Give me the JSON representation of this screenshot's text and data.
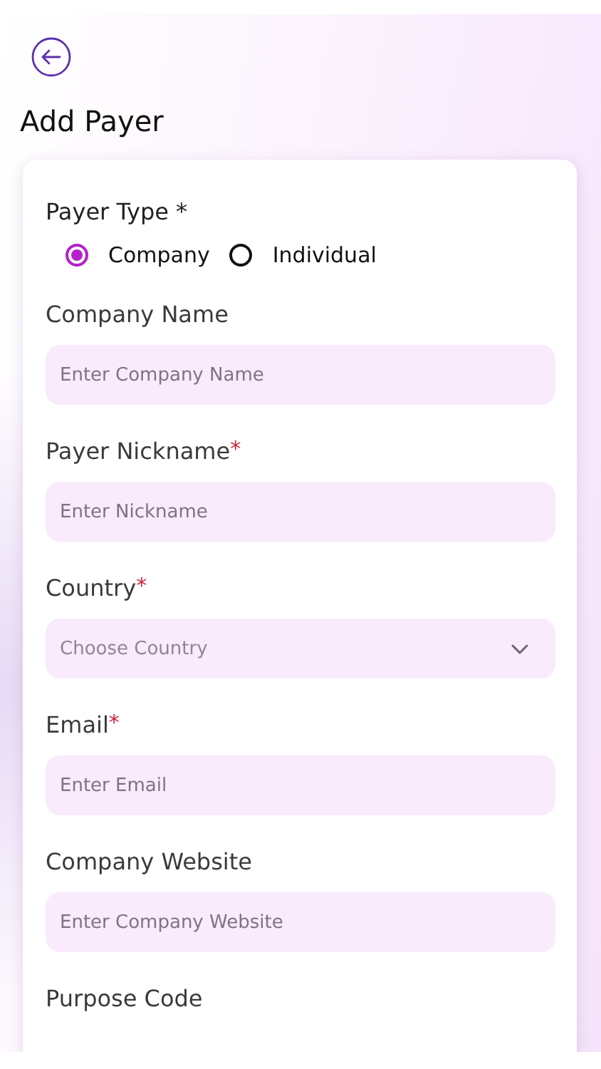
{
  "header": {
    "title": "Add Payer"
  },
  "payer_type": {
    "label": "Payer Type *",
    "options": [
      {
        "label": "Company",
        "selected": true
      },
      {
        "label": "Individual",
        "selected": false
      }
    ]
  },
  "fields": [
    {
      "kind": "text",
      "label": "Company Name",
      "placeholder": "Enter Company Name"
    },
    {
      "kind": "text",
      "label": "Payer Nickname",
      "required_mark": "*",
      "placeholder": "Enter Nickname"
    },
    {
      "kind": "select",
      "label": "Country",
      "required_mark": "*",
      "placeholder": "Choose Country"
    },
    {
      "kind": "text",
      "label": "Email",
      "required_mark": "*",
      "placeholder": "Enter Email"
    },
    {
      "kind": "text",
      "label": "Company Website",
      "placeholder": "Enter Company Website"
    },
    {
      "kind": "label",
      "label": "Purpose Code"
    }
  ]
}
